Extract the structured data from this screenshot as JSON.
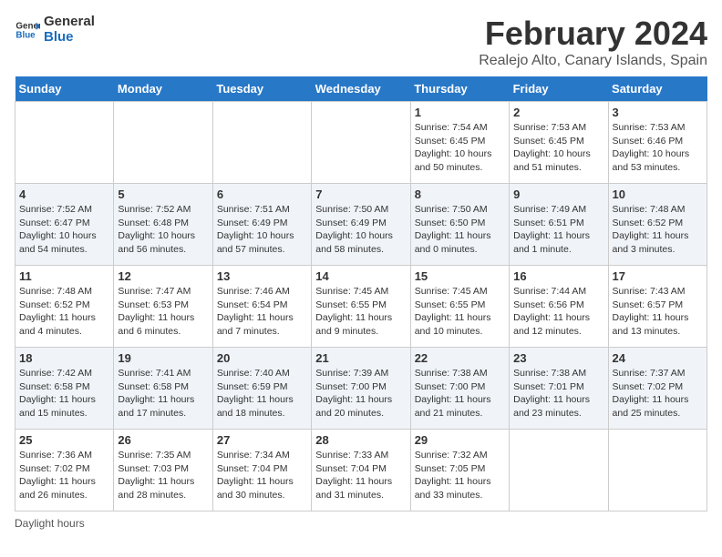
{
  "header": {
    "logo_line1": "General",
    "logo_line2": "Blue",
    "month": "February 2024",
    "location": "Realejo Alto, Canary Islands, Spain"
  },
  "days_of_week": [
    "Sunday",
    "Monday",
    "Tuesday",
    "Wednesday",
    "Thursday",
    "Friday",
    "Saturday"
  ],
  "weeks": [
    [
      {
        "date": "",
        "info": ""
      },
      {
        "date": "",
        "info": ""
      },
      {
        "date": "",
        "info": ""
      },
      {
        "date": "",
        "info": ""
      },
      {
        "date": "1",
        "info": "Sunrise: 7:54 AM\nSunset: 6:45 PM\nDaylight: 10 hours and 50 minutes."
      },
      {
        "date": "2",
        "info": "Sunrise: 7:53 AM\nSunset: 6:45 PM\nDaylight: 10 hours and 51 minutes."
      },
      {
        "date": "3",
        "info": "Sunrise: 7:53 AM\nSunset: 6:46 PM\nDaylight: 10 hours and 53 minutes."
      }
    ],
    [
      {
        "date": "4",
        "info": "Sunrise: 7:52 AM\nSunset: 6:47 PM\nDaylight: 10 hours and 54 minutes."
      },
      {
        "date": "5",
        "info": "Sunrise: 7:52 AM\nSunset: 6:48 PM\nDaylight: 10 hours and 56 minutes."
      },
      {
        "date": "6",
        "info": "Sunrise: 7:51 AM\nSunset: 6:49 PM\nDaylight: 10 hours and 57 minutes."
      },
      {
        "date": "7",
        "info": "Sunrise: 7:50 AM\nSunset: 6:49 PM\nDaylight: 10 hours and 58 minutes."
      },
      {
        "date": "8",
        "info": "Sunrise: 7:50 AM\nSunset: 6:50 PM\nDaylight: 11 hours and 0 minutes."
      },
      {
        "date": "9",
        "info": "Sunrise: 7:49 AM\nSunset: 6:51 PM\nDaylight: 11 hours and 1 minute."
      },
      {
        "date": "10",
        "info": "Sunrise: 7:48 AM\nSunset: 6:52 PM\nDaylight: 11 hours and 3 minutes."
      }
    ],
    [
      {
        "date": "11",
        "info": "Sunrise: 7:48 AM\nSunset: 6:52 PM\nDaylight: 11 hours and 4 minutes."
      },
      {
        "date": "12",
        "info": "Sunrise: 7:47 AM\nSunset: 6:53 PM\nDaylight: 11 hours and 6 minutes."
      },
      {
        "date": "13",
        "info": "Sunrise: 7:46 AM\nSunset: 6:54 PM\nDaylight: 11 hours and 7 minutes."
      },
      {
        "date": "14",
        "info": "Sunrise: 7:45 AM\nSunset: 6:55 PM\nDaylight: 11 hours and 9 minutes."
      },
      {
        "date": "15",
        "info": "Sunrise: 7:45 AM\nSunset: 6:55 PM\nDaylight: 11 hours and 10 minutes."
      },
      {
        "date": "16",
        "info": "Sunrise: 7:44 AM\nSunset: 6:56 PM\nDaylight: 11 hours and 12 minutes."
      },
      {
        "date": "17",
        "info": "Sunrise: 7:43 AM\nSunset: 6:57 PM\nDaylight: 11 hours and 13 minutes."
      }
    ],
    [
      {
        "date": "18",
        "info": "Sunrise: 7:42 AM\nSunset: 6:58 PM\nDaylight: 11 hours and 15 minutes."
      },
      {
        "date": "19",
        "info": "Sunrise: 7:41 AM\nSunset: 6:58 PM\nDaylight: 11 hours and 17 minutes."
      },
      {
        "date": "20",
        "info": "Sunrise: 7:40 AM\nSunset: 6:59 PM\nDaylight: 11 hours and 18 minutes."
      },
      {
        "date": "21",
        "info": "Sunrise: 7:39 AM\nSunset: 7:00 PM\nDaylight: 11 hours and 20 minutes."
      },
      {
        "date": "22",
        "info": "Sunrise: 7:38 AM\nSunset: 7:00 PM\nDaylight: 11 hours and 21 minutes."
      },
      {
        "date": "23",
        "info": "Sunrise: 7:38 AM\nSunset: 7:01 PM\nDaylight: 11 hours and 23 minutes."
      },
      {
        "date": "24",
        "info": "Sunrise: 7:37 AM\nSunset: 7:02 PM\nDaylight: 11 hours and 25 minutes."
      }
    ],
    [
      {
        "date": "25",
        "info": "Sunrise: 7:36 AM\nSunset: 7:02 PM\nDaylight: 11 hours and 26 minutes."
      },
      {
        "date": "26",
        "info": "Sunrise: 7:35 AM\nSunset: 7:03 PM\nDaylight: 11 hours and 28 minutes."
      },
      {
        "date": "27",
        "info": "Sunrise: 7:34 AM\nSunset: 7:04 PM\nDaylight: 11 hours and 30 minutes."
      },
      {
        "date": "28",
        "info": "Sunrise: 7:33 AM\nSunset: 7:04 PM\nDaylight: 11 hours and 31 minutes."
      },
      {
        "date": "29",
        "info": "Sunrise: 7:32 AM\nSunset: 7:05 PM\nDaylight: 11 hours and 33 minutes."
      },
      {
        "date": "",
        "info": ""
      },
      {
        "date": "",
        "info": ""
      }
    ]
  ],
  "footer": {
    "note": "Daylight hours"
  }
}
